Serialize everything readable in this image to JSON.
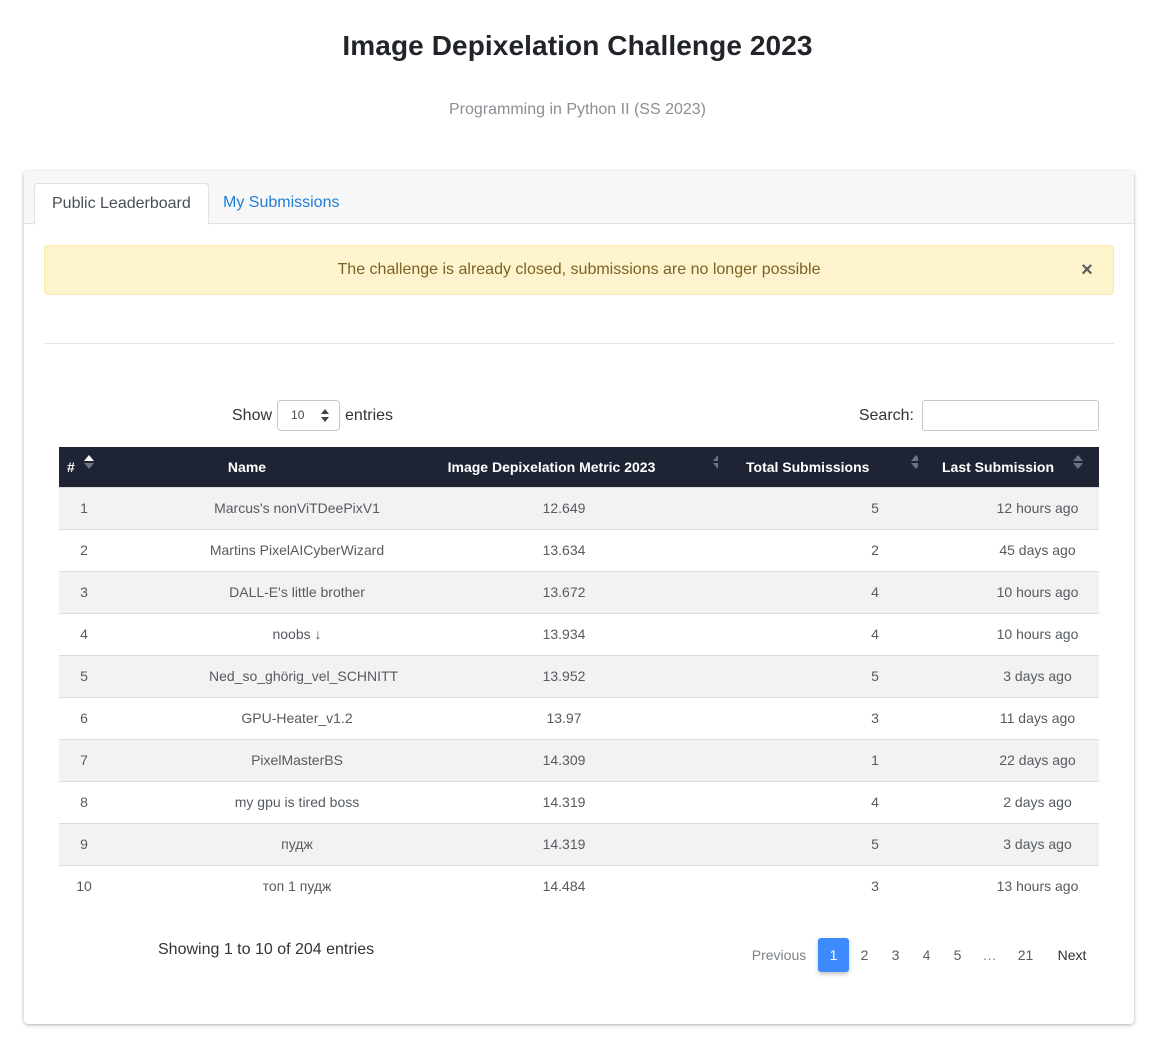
{
  "header": {
    "title": "Image Depixelation Challenge 2023",
    "subtitle": "Programming in Python II (SS 2023)"
  },
  "tabs": [
    {
      "label": "Public Leaderboard",
      "active": true
    },
    {
      "label": "My Submissions",
      "active": false
    }
  ],
  "alert": {
    "message": "The challenge is already closed, submissions are no longer possible",
    "close_label": "×"
  },
  "controls": {
    "show_label": "Show",
    "entries_label": "entries",
    "page_length": "10",
    "search_label": "Search:",
    "search_value": ""
  },
  "table": {
    "columns": [
      "#",
      "Name",
      "Image Depixelation Metric 2023",
      "Total Submissions",
      "Last Submission"
    ],
    "rows": [
      [
        "1",
        "Marcus's nonViTDeePixV1",
        "12.649",
        "5",
        "12 hours ago"
      ],
      [
        "2",
        "Martins PixelAICyberWizard",
        "13.634",
        "2",
        "45 days ago"
      ],
      [
        "3",
        "DALL-E's little brother",
        "13.672",
        "4",
        "10 hours ago"
      ],
      [
        "4",
        "noobs ↓",
        "13.934",
        "4",
        "10 hours ago"
      ],
      [
        "5",
        "Ned_so_ghörig_vel_SCHNITT",
        "13.952",
        "5",
        "3 days ago"
      ],
      [
        "6",
        "GPU-Heater_v1.2",
        "13.97",
        "3",
        "11 days ago"
      ],
      [
        "7",
        "PixelMasterBS",
        "14.309",
        "1",
        "22 days ago"
      ],
      [
        "8",
        "my gpu is tired boss",
        "14.319",
        "4",
        "2 days ago"
      ],
      [
        "9",
        "пудж",
        "14.319",
        "5",
        "3 days ago"
      ],
      [
        "10",
        "топ 1 пудж",
        "14.484",
        "3",
        "13 hours ago"
      ]
    ]
  },
  "footer": {
    "info": "Showing 1 to 10 of 204 entries",
    "previous_label": "Previous",
    "pages": [
      "1",
      "2",
      "3",
      "4",
      "5"
    ],
    "ellipsis": "…",
    "last_page": "21",
    "next_label": "Next",
    "current_page": "1"
  },
  "colors": {
    "table_header_bg": "#1f2434",
    "tab_link": "#1f7fd8",
    "alert_bg": "#fdf3cd",
    "alert_text": "#7b6325",
    "page_active": "#3d8bfd"
  }
}
